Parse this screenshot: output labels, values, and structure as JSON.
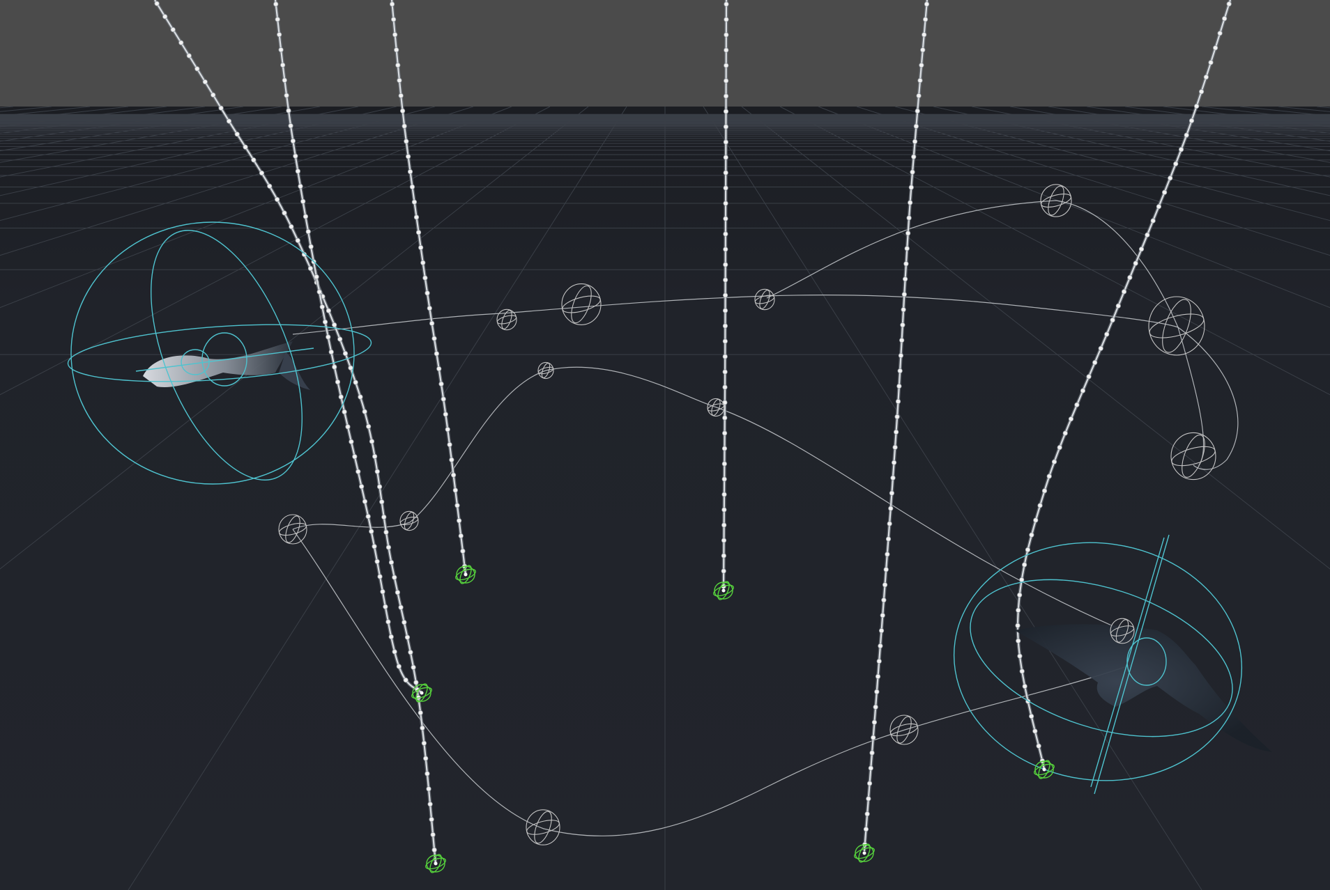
{
  "viewport": {
    "name": "3d-viewport",
    "colors": {
      "sky": "#4b4b4b",
      "ground": "#20232a",
      "grid_line": "#3a3f47",
      "rope": "#d8dce0",
      "rope_node": "#f2f2f2",
      "path_curve": "#c9ccd0",
      "path_node": "#c4c4c4",
      "anchor": "#56d23c",
      "bound": "#4fc3cf",
      "creature_body": "#2c3440"
    },
    "icons": {
      "path_node": "gizmo-sphere-icon",
      "rope_anchor": "anchor-gizmo-icon",
      "bounds": "bounding-sphere-icon"
    }
  }
}
